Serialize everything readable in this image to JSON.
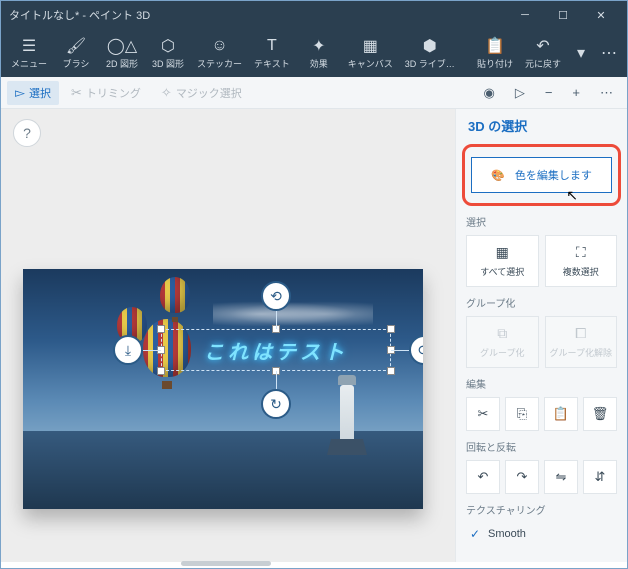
{
  "titlebar": {
    "title": "タイトルなし* - ペイント 3D"
  },
  "ribbon": {
    "menu": "メニュー",
    "brush": "ブラシ",
    "shapes2d": "2D 図形",
    "shapes3d": "3D 図形",
    "sticker": "ステッカー",
    "text": "テキスト",
    "effects": "効果",
    "canvas": "キャンバス",
    "lib3d": "3D ライブ…",
    "paste": "貼り付け",
    "undo": "元に戻す"
  },
  "toolbar": {
    "select": "選択",
    "trimming": "トリミング",
    "magic": "マジック選択"
  },
  "canvas": {
    "selection_text": "これはテスト"
  },
  "side": {
    "title": "3D の選択",
    "edit_color": "色を編集します",
    "sec_select": "選択",
    "select_all": "すべて選択",
    "multi_select": "複数選択",
    "sec_group": "グループ化",
    "group": "グループ化",
    "ungroup": "グループ化解除",
    "sec_edit": "編集",
    "sec_rotate": "回転と反転",
    "sec_texture": "テクスチャリング",
    "smooth": "Smooth"
  }
}
